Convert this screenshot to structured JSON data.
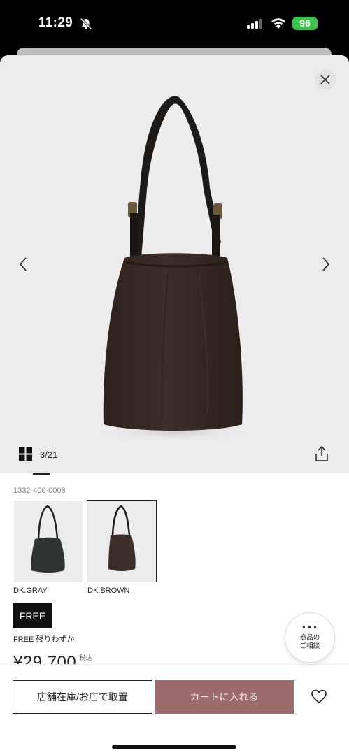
{
  "status_bar": {
    "time": "11:29",
    "battery": "96"
  },
  "gallery": {
    "counter": "3/21"
  },
  "product": {
    "sku": "1332-400-0008",
    "colors": [
      {
        "label": "DK.GRAY",
        "selected": false,
        "swatch_color": "#2d3431"
      },
      {
        "label": "DK.BROWN",
        "selected": true,
        "swatch_color": "#3b2d27"
      }
    ],
    "size": {
      "label": "FREE",
      "stock_note": "FREE 残りわずか"
    },
    "price": "¥29,700",
    "price_tax_label": "税込"
  },
  "consult": {
    "label_line1": "商品の",
    "label_line2": "ご相談"
  },
  "actions": {
    "store_stock_label": "店舗在庫/お店で取置",
    "add_to_cart_label": "カートに入れる"
  },
  "colors": {
    "cart_button": "#9c6b6b",
    "battery": "#3ac24a"
  }
}
